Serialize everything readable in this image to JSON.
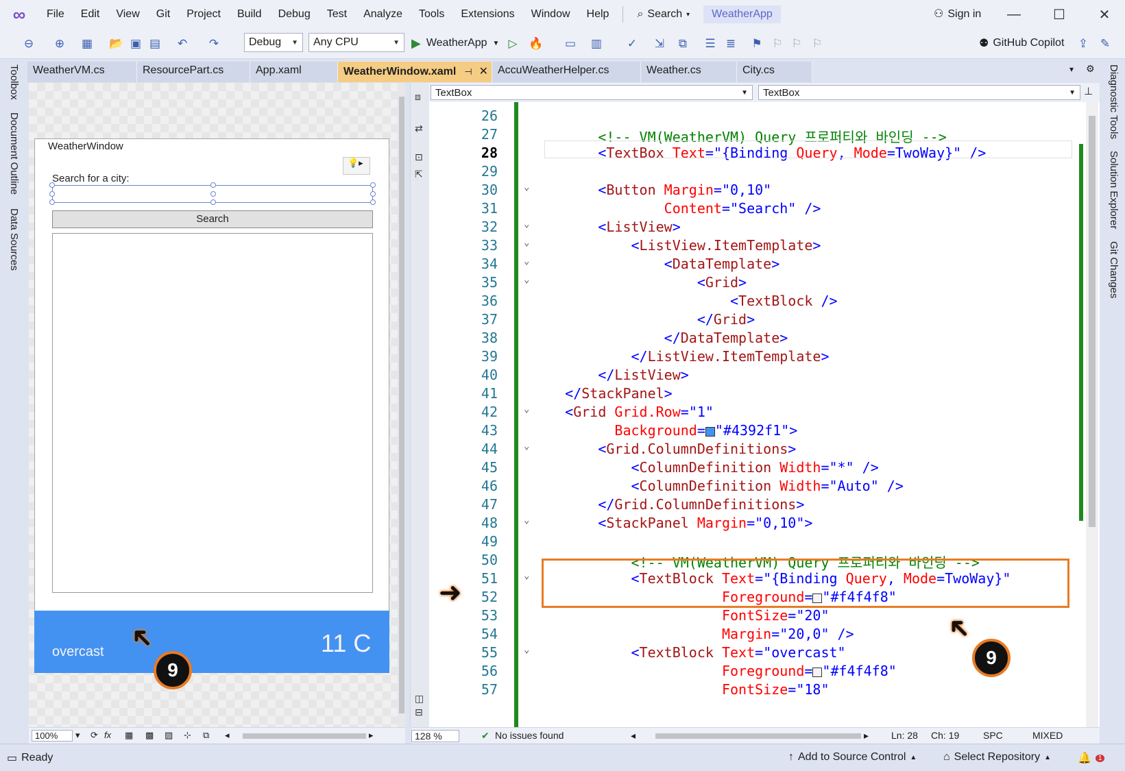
{
  "menubar": {
    "items": [
      "File",
      "Edit",
      "View",
      "Git",
      "Project",
      "Build",
      "Debug",
      "Test",
      "Analyze",
      "Tools",
      "Extensions",
      "Window",
      "Help"
    ],
    "search_label": "Search",
    "app_name": "WeatherApp",
    "sign_in": "Sign in"
  },
  "toolbar": {
    "config": "Debug",
    "platform": "Any CPU",
    "run_target": "WeatherApp",
    "copilot": "GitHub Copilot"
  },
  "left_rail": [
    "Toolbox",
    "Document Outline",
    "Data Sources"
  ],
  "right_rail": [
    "Diagnostic Tools",
    "Solution Explorer",
    "Git Changes"
  ],
  "doc_tabs": [
    "WeatherVM.cs",
    "ResourcePart.cs",
    "App.xaml",
    "WeatherWindow.xaml",
    "AccuWeatherHelper.cs",
    "Weather.cs",
    "City.cs"
  ],
  "designer": {
    "window_title": "WeatherWindow",
    "search_label": "Search for a city:",
    "search_button": "Search",
    "weather_desc": "overcast",
    "weather_temp": "11 C",
    "zoom": "100%"
  },
  "editor": {
    "nav_left": "TextBox",
    "nav_right": "TextBox",
    "zoom": "128 %",
    "issues": "No issues found",
    "line": "Ln: 28",
    "col": "Ch: 19",
    "spc": "SPC",
    "eol": "MIXED",
    "lines": [
      {
        "n": "26",
        "t": []
      },
      {
        "n": "27",
        "t": [
          [
            "cmt",
            "        <!-- VM(WeatherVM) Query 프로퍼티와 바인딩 -->"
          ]
        ]
      },
      {
        "n": "28",
        "t": [
          [
            "tag",
            "        <"
          ],
          [
            "name",
            "TextBox"
          ],
          [
            "attr",
            " Text"
          ],
          [
            "punct",
            "="
          ],
          [
            "str",
            "\"{Binding "
          ],
          [
            "attr",
            "Query"
          ],
          [
            "str",
            ", "
          ],
          [
            "attr",
            "Mode"
          ],
          [
            "str",
            "=TwoWay}\""
          ],
          [
            "tag",
            " />"
          ]
        ]
      },
      {
        "n": "29",
        "t": []
      },
      {
        "n": "30",
        "t": [
          [
            "tag",
            "        <"
          ],
          [
            "name",
            "Button"
          ],
          [
            "attr",
            " Margin"
          ],
          [
            "punct",
            "="
          ],
          [
            "str",
            "\"0,10\""
          ]
        ]
      },
      {
        "n": "31",
        "t": [
          [
            "attr",
            "                Content"
          ],
          [
            "punct",
            "="
          ],
          [
            "str",
            "\"Search\""
          ],
          [
            "tag",
            " />"
          ]
        ]
      },
      {
        "n": "32",
        "t": [
          [
            "tag",
            "        <"
          ],
          [
            "name",
            "ListView"
          ],
          [
            "tag",
            ">"
          ]
        ]
      },
      {
        "n": "33",
        "t": [
          [
            "tag",
            "            <"
          ],
          [
            "name",
            "ListView.ItemTemplate"
          ],
          [
            "tag",
            ">"
          ]
        ]
      },
      {
        "n": "34",
        "t": [
          [
            "tag",
            "                <"
          ],
          [
            "name",
            "DataTemplate"
          ],
          [
            "tag",
            ">"
          ]
        ]
      },
      {
        "n": "35",
        "t": [
          [
            "tag",
            "                    <"
          ],
          [
            "name",
            "Grid"
          ],
          [
            "tag",
            ">"
          ]
        ]
      },
      {
        "n": "36",
        "t": [
          [
            "tag",
            "                        <"
          ],
          [
            "name",
            "TextBlock"
          ],
          [
            "tag",
            " />"
          ]
        ]
      },
      {
        "n": "37",
        "t": [
          [
            "tag",
            "                    </"
          ],
          [
            "name",
            "Grid"
          ],
          [
            "tag",
            ">"
          ]
        ]
      },
      {
        "n": "38",
        "t": [
          [
            "tag",
            "                </"
          ],
          [
            "name",
            "DataTemplate"
          ],
          [
            "tag",
            ">"
          ]
        ]
      },
      {
        "n": "39",
        "t": [
          [
            "tag",
            "            </"
          ],
          [
            "name",
            "ListView.ItemTemplate"
          ],
          [
            "tag",
            ">"
          ]
        ]
      },
      {
        "n": "40",
        "t": [
          [
            "tag",
            "        </"
          ],
          [
            "name",
            "ListView"
          ],
          [
            "tag",
            ">"
          ]
        ]
      },
      {
        "n": "41",
        "t": [
          [
            "tag",
            "    </"
          ],
          [
            "name",
            "StackPanel"
          ],
          [
            "tag",
            ">"
          ]
        ]
      },
      {
        "n": "42",
        "t": [
          [
            "tag",
            "    <"
          ],
          [
            "name",
            "Grid"
          ],
          [
            "attr",
            " Grid.Row"
          ],
          [
            "punct",
            "="
          ],
          [
            "str",
            "\"1\""
          ]
        ]
      },
      {
        "n": "43",
        "t": [
          [
            "attr",
            "          Background"
          ],
          [
            "punct",
            "="
          ],
          [
            "swatch",
            "#4392f1"
          ],
          [
            "str",
            "\"#4392f1\""
          ],
          [
            "tag",
            ">"
          ]
        ]
      },
      {
        "n": "44",
        "t": [
          [
            "tag",
            "        <"
          ],
          [
            "name",
            "Grid.ColumnDefinitions"
          ],
          [
            "tag",
            ">"
          ]
        ]
      },
      {
        "n": "45",
        "t": [
          [
            "tag",
            "            <"
          ],
          [
            "name",
            "ColumnDefinition"
          ],
          [
            "attr",
            " Width"
          ],
          [
            "punct",
            "="
          ],
          [
            "str",
            "\"*\""
          ],
          [
            "tag",
            " />"
          ]
        ]
      },
      {
        "n": "46",
        "t": [
          [
            "tag",
            "            <"
          ],
          [
            "name",
            "ColumnDefinition"
          ],
          [
            "attr",
            " Width"
          ],
          [
            "punct",
            "="
          ],
          [
            "str",
            "\"Auto\""
          ],
          [
            "tag",
            " />"
          ]
        ]
      },
      {
        "n": "47",
        "t": [
          [
            "tag",
            "        </"
          ],
          [
            "name",
            "Grid.ColumnDefinitions"
          ],
          [
            "tag",
            ">"
          ]
        ]
      },
      {
        "n": "48",
        "t": [
          [
            "tag",
            "        <"
          ],
          [
            "name",
            "StackPanel"
          ],
          [
            "attr",
            " Margin"
          ],
          [
            "punct",
            "="
          ],
          [
            "str",
            "\"0,10\""
          ],
          [
            "tag",
            ">"
          ]
        ]
      },
      {
        "n": "49",
        "t": []
      },
      {
        "n": "50",
        "t": [
          [
            "cmt",
            "            <!-- VM(WeatherVM) Query 프로퍼티와 바인딩 -->"
          ]
        ]
      },
      {
        "n": "51",
        "t": [
          [
            "tag",
            "            <"
          ],
          [
            "name",
            "TextBlock"
          ],
          [
            "attr",
            " Text"
          ],
          [
            "punct",
            "="
          ],
          [
            "str",
            "\"{Binding "
          ],
          [
            "attr",
            "Query"
          ],
          [
            "str",
            ", "
          ],
          [
            "attr",
            "Mode"
          ],
          [
            "str",
            "=TwoWay}\""
          ]
        ]
      },
      {
        "n": "52",
        "t": [
          [
            "attr",
            "                       Foreground"
          ],
          [
            "punct",
            "="
          ],
          [
            "swatch",
            "#f4f4f8"
          ],
          [
            "str",
            "\"#f4f4f8\""
          ]
        ]
      },
      {
        "n": "53",
        "t": [
          [
            "attr",
            "                       FontSize"
          ],
          [
            "punct",
            "="
          ],
          [
            "str",
            "\"20\""
          ]
        ]
      },
      {
        "n": "54",
        "t": [
          [
            "attr",
            "                       Margin"
          ],
          [
            "punct",
            "="
          ],
          [
            "str",
            "\"20,0\""
          ],
          [
            "tag",
            " />"
          ]
        ]
      },
      {
        "n": "55",
        "t": [
          [
            "tag",
            "            <"
          ],
          [
            "name",
            "TextBlock"
          ],
          [
            "attr",
            " Text"
          ],
          [
            "punct",
            "="
          ],
          [
            "str",
            "\"overcast\""
          ]
        ]
      },
      {
        "n": "56",
        "t": [
          [
            "attr",
            "                       Foreground"
          ],
          [
            "punct",
            "="
          ],
          [
            "swatch",
            "#f4f4f8"
          ],
          [
            "str",
            "\"#f4f4f8\""
          ]
        ]
      },
      {
        "n": "57",
        "t": [
          [
            "attr",
            "                       FontSize"
          ],
          [
            "punct",
            "="
          ],
          [
            "str",
            "\"18\""
          ]
        ]
      }
    ]
  },
  "callout_label": "9",
  "statusbar": {
    "ready": "Ready",
    "source_control": "Add to Source Control",
    "repository": "Select Repository",
    "notifications": "1"
  },
  "colors": {
    "accent": "#e87b24",
    "weather_bg": "#4392f1",
    "active_tab": "#f5cc84",
    "change_bar": "#1e8a1e"
  }
}
